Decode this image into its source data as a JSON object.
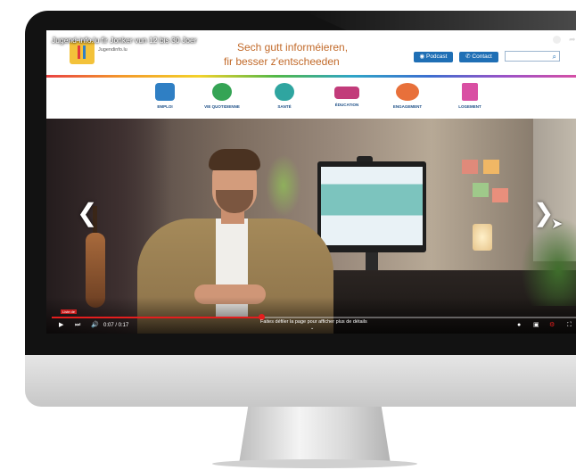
{
  "video": {
    "title": "Jugend-info.lu fir Jonker vun 12 bis 30 Joer",
    "chapter_label": "Liste de",
    "time_display": "0:07 / 0:17",
    "progress": 0.4,
    "hint": "Faites défiler la page pour afficher plus de détails",
    "hint_arrow": "⌄"
  },
  "site": {
    "logo_text": "Jugendinfo.lu",
    "slogan_line1": "Sech gutt informéieren,",
    "slogan_line2": "fir besser z'entscheeden",
    "podcast_label": "Podcast",
    "contact_label": "Contact",
    "search_placeholder": ""
  },
  "nav": {
    "items": [
      {
        "label": "EMPLOI",
        "icon": "briefcase-icon",
        "color": "#2f7fc4"
      },
      {
        "label": "VIE QUOTIDIENNE",
        "icon": "chat-bubble-icon",
        "color": "#35a455"
      },
      {
        "label": "SANTÉ",
        "icon": "heart-pulse-icon",
        "color": "#2fa5a0"
      },
      {
        "label": "ÉDUCATION",
        "icon": "graduation-cap-icon",
        "color": "#c23b7a"
      },
      {
        "label": "ENGAGEMENT",
        "icon": "people-icon",
        "color": "#e8703a"
      },
      {
        "label": "LOGEMENT",
        "icon": "house-icon",
        "color": "#d94fa3"
      }
    ]
  },
  "colors": {
    "accent": "#1f6fb5",
    "slogan": "#c26a2a",
    "progress": "#e41e1e"
  }
}
